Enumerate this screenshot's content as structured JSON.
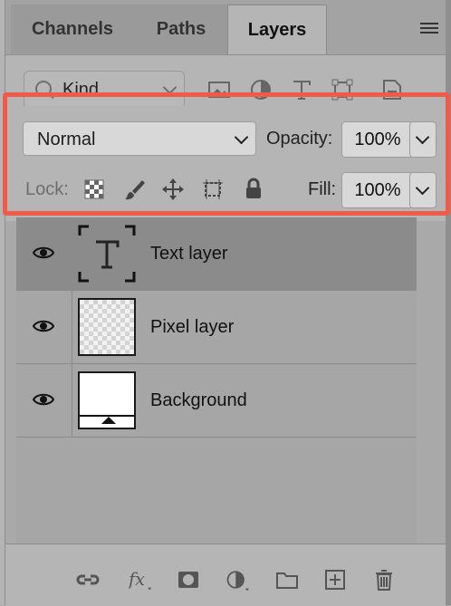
{
  "tabs": [
    {
      "label": "Channels"
    },
    {
      "label": "Paths"
    },
    {
      "label": "Layers"
    }
  ],
  "filter": {
    "kind_label": "Kind",
    "icons": [
      "image-icon",
      "adjustment-icon",
      "type-icon",
      "shape-icon",
      "smart-object-icon"
    ]
  },
  "blend": {
    "mode": "Normal"
  },
  "opacity": {
    "label": "Opacity:",
    "value": "100%"
  },
  "lock": {
    "label": "Lock:",
    "icons": [
      "lock-transparent-pixels-icon",
      "lock-image-pixels-icon",
      "lock-position-icon",
      "lock-artboard-icon",
      "lock-all-icon"
    ]
  },
  "fill": {
    "label": "Fill:",
    "value": "100%"
  },
  "layers": [
    {
      "name": "Text layer",
      "type": "text",
      "visible": true,
      "selected": true
    },
    {
      "name": "Pixel layer",
      "type": "pixel",
      "visible": true,
      "selected": false
    },
    {
      "name": "Background",
      "type": "background",
      "visible": true,
      "selected": false
    }
  ],
  "bottom_icons": [
    "link-layers-icon",
    "fx-icon",
    "mask-icon",
    "adjustment-layer-icon",
    "group-icon",
    "new-layer-icon",
    "trash-icon"
  ],
  "colors": {
    "highlight": "#f05a48",
    "selected_row": "#8b8b8b",
    "panel": "#b5b5b5"
  }
}
